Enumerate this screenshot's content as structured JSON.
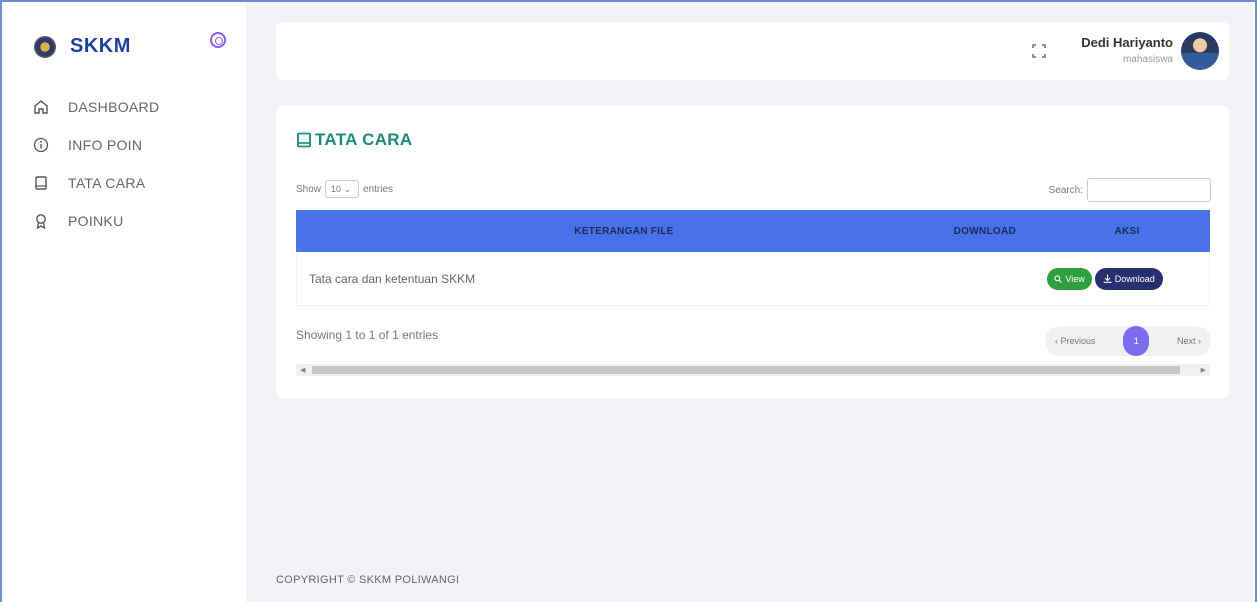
{
  "brand": {
    "name": "SKKM"
  },
  "sidebar": {
    "items": [
      {
        "label": "DASHBOARD",
        "icon": "home-icon"
      },
      {
        "label": "INFO POIN",
        "icon": "info-icon"
      },
      {
        "label": "TATA CARA",
        "icon": "book-icon"
      },
      {
        "label": "POINKU",
        "icon": "award-icon"
      }
    ]
  },
  "header": {
    "user_name": "Dedi Hariyanto",
    "user_role": "mahasiswa"
  },
  "card": {
    "title": "TATA CARA",
    "show_label": "Show",
    "entries_value": "10",
    "entries_label": "entries",
    "search_label": "Search:",
    "search_value": ""
  },
  "table": {
    "headers": [
      "KETERANGAN FILE",
      "DOWNLOAD",
      "AKSI"
    ],
    "rows": [
      {
        "file": "Tata cara dan ketentuan SKKM",
        "view_label": "View",
        "download_label": "Download"
      }
    ],
    "info": "Showing 1 to 1 of 1 entries"
  },
  "pagination": {
    "previous": "‹ Previous",
    "current": "1",
    "next": "Next ›"
  },
  "footer": {
    "text": "COPYRIGHT © SKKM POLIWANGI"
  },
  "colors": {
    "accent": "#4a72e8",
    "title": "#1c8a7a",
    "view": "#2e9e3e",
    "download": "#27306e",
    "page": "#7b6cf0"
  }
}
